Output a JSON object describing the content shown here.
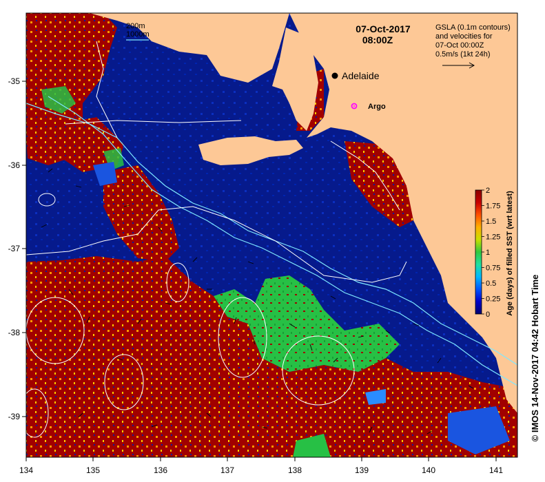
{
  "header": {
    "date": "07-Oct-2017",
    "time": "08:00Z"
  },
  "legend": {
    "contour_200": "200m",
    "contour_1000": "1000m",
    "gsla_lines": [
      "GSLA (0.1m contours)",
      "and velocities for",
      "07-Oct 00:00Z",
      "0.5m/s (1kt 24h)"
    ]
  },
  "places": {
    "adelaide": "Adelaide",
    "argo": "Argo"
  },
  "colorbar": {
    "title": "Age (days) of filled SST (wrt latest)",
    "ticks": [
      "2",
      "1.75",
      "1.5",
      "1.25",
      "1",
      "0.75",
      "0.5",
      "0.25",
      "0"
    ],
    "colors": [
      "#00006f",
      "#0000c8",
      "#0055ff",
      "#00b8ff",
      "#20e0a0",
      "#30c840",
      "#c8e000",
      "#ffb000",
      "#ff5000",
      "#c80000",
      "#8b0000"
    ]
  },
  "axes": {
    "x_ticks": [
      "134",
      "135",
      "136",
      "137",
      "138",
      "139",
      "140",
      "141"
    ],
    "y_ticks": [
      "-35",
      "-36",
      "-37",
      "-38",
      "-39"
    ]
  },
  "credit": "© IMOS 14-Nov-2017 04:42 Hobart Time",
  "colors": {
    "land": "#fdc896",
    "ocean_age0": "#061a8c",
    "age_max": "#a10000",
    "age_mid": "#27c045",
    "white_contour": "#ffffff",
    "cyan_contour": "#7fe8ff",
    "argo_marker": "#ff00ff"
  }
}
